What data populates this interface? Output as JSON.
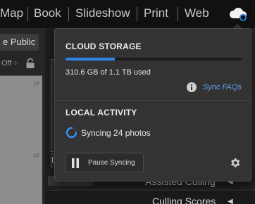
{
  "topbar": {
    "modules": [
      "Map",
      "Book",
      "Slideshow",
      "Print",
      "Web"
    ],
    "cloud_icon": "cloud-sync-icon"
  },
  "left_panel": {
    "make_public_label": "e Public",
    "off_label": "Off ÷",
    "lock_icon": "lock-icon"
  },
  "middle": {
    "letter": "D"
  },
  "right_panel": {
    "rows": [
      {
        "label": "Assisted Culling",
        "indicator": "◀"
      },
      {
        "label": "Culling Scores",
        "indicator": "◀"
      }
    ]
  },
  "popup": {
    "cloud_storage": {
      "title": "CLOUD STORAGE",
      "used_fraction": 0.28,
      "used_text": "310.6 GB of 1.1 TB used",
      "info_icon": "info-icon",
      "faq_link": "Sync FAQs"
    },
    "local_activity": {
      "title": "LOCAL ACTIVITY",
      "status_text": "Syncing 24 photos",
      "spinner_icon": "sync-spinner-icon"
    },
    "pause_button": {
      "label": "Pause Syncing",
      "icon": "pause-icon"
    },
    "settings_icon": "gear-icon"
  },
  "colors": {
    "accent": "#2f86e8",
    "link": "#5aa7f2",
    "popup_bg": "#333333",
    "topbar_bg": "#111111"
  }
}
